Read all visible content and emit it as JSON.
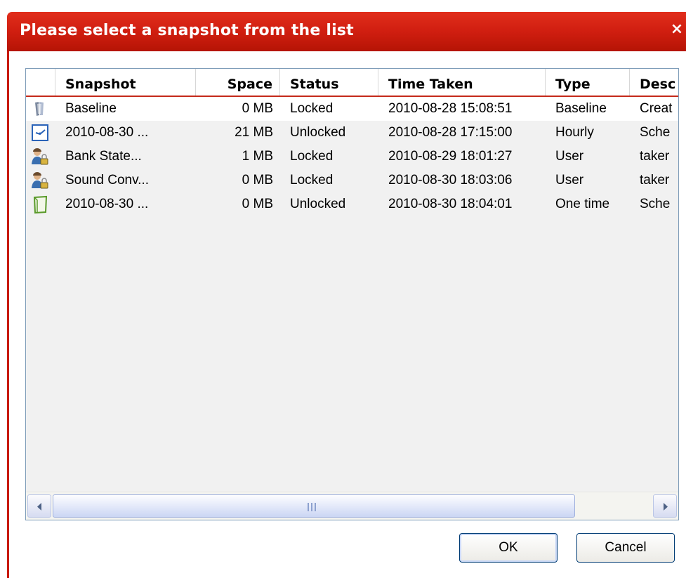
{
  "dialog": {
    "title": "Please select a snapshot from the list",
    "close_glyph": "×"
  },
  "table": {
    "columns": [
      "Snapshot",
      "Space",
      "Status",
      "Time Taken",
      "Type",
      "Desc"
    ],
    "rows": [
      {
        "icon": "baseline-icon",
        "snapshot": "Baseline",
        "space": "0 MB",
        "status": "Locked",
        "time": "2010-08-28 15:08:51",
        "type": "Baseline",
        "desc": "Creat"
      },
      {
        "icon": "scheduled-clock-icon",
        "snapshot": "2010-08-30 ...",
        "space": "21 MB",
        "status": "Unlocked",
        "time": "2010-08-28 17:15:00",
        "type": "Hourly",
        "desc": "Sche"
      },
      {
        "icon": "user-lock-icon",
        "snapshot": "Bank State...",
        "space": "1 MB",
        "status": "Locked",
        "time": "2010-08-29 18:01:27",
        "type": "User",
        "desc": "taker"
      },
      {
        "icon": "user-lock-icon",
        "snapshot": "Sound Conv...",
        "space": "0 MB",
        "status": "Locked",
        "time": "2010-08-30 18:03:06",
        "type": "User",
        "desc": "taker"
      },
      {
        "icon": "one-time-icon",
        "snapshot": "2010-08-30 ...",
        "space": "0 MB",
        "status": "Unlocked",
        "time": "2010-08-30 18:04:01",
        "type": "One time",
        "desc": "Sche"
      }
    ]
  },
  "buttons": {
    "ok": "OK",
    "cancel": "Cancel"
  },
  "colors": {
    "title_bar": "#d01e10",
    "header_underline": "#c5291a",
    "list_background": "#f1f1f1"
  }
}
